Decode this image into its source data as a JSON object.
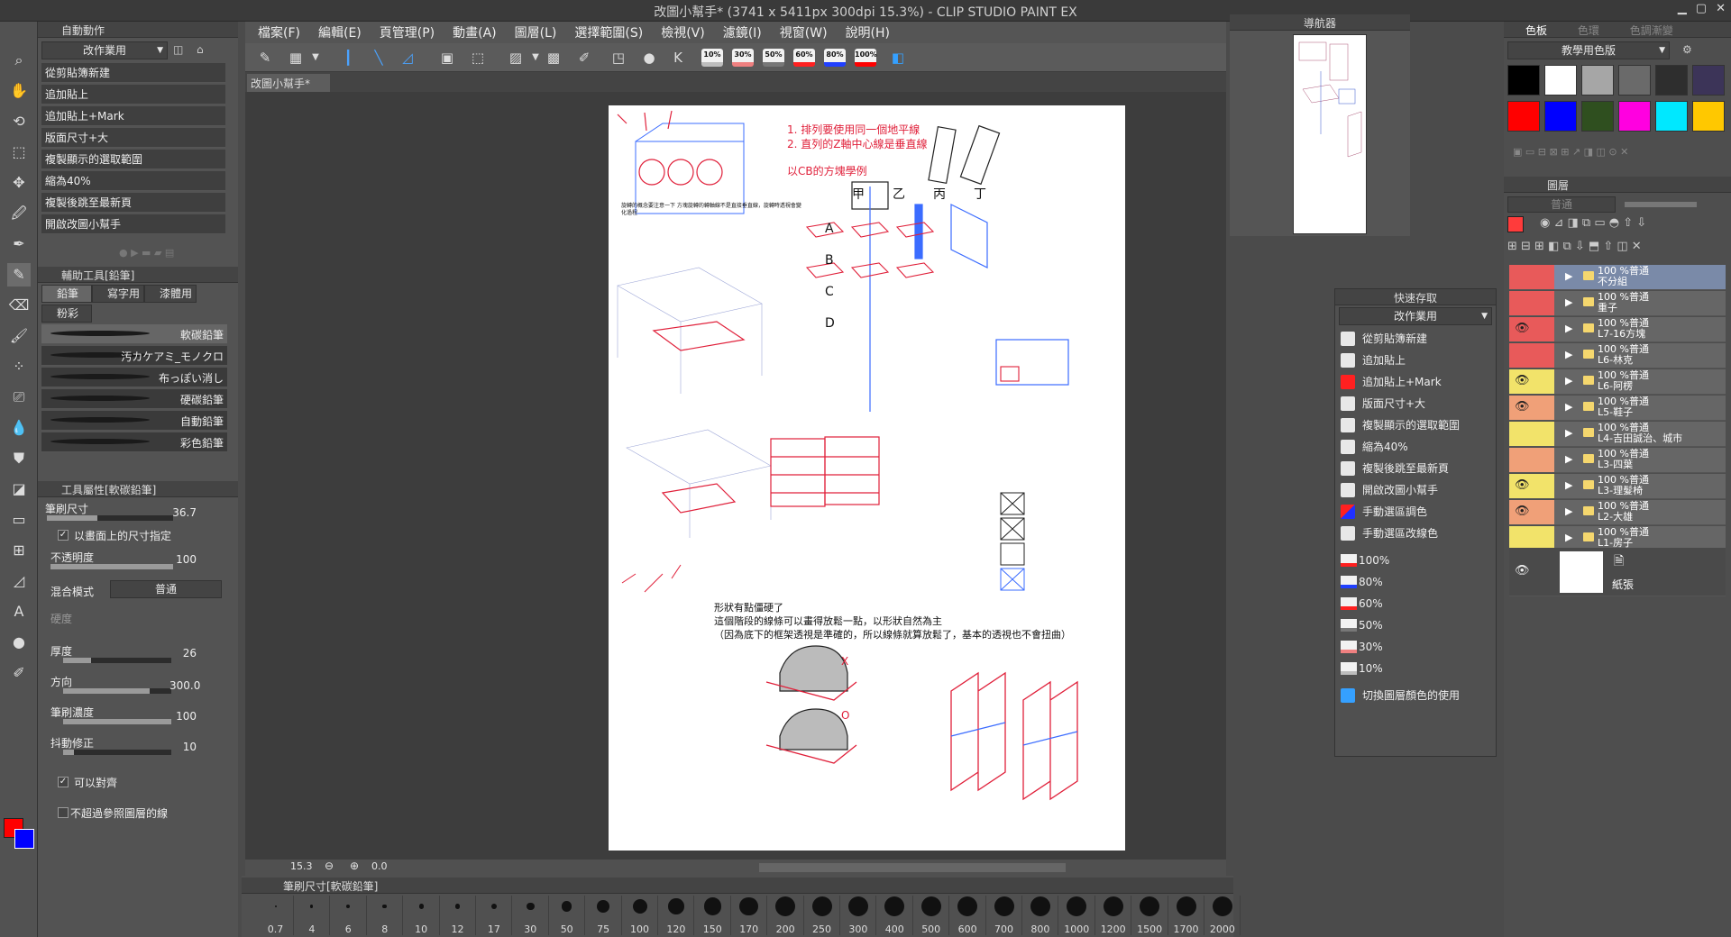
{
  "window": {
    "title": "改圖小幫手* (3741 x 5411px 300dpi 15.3%) - CLIP STUDIO PAINT EX"
  },
  "menu": [
    "檔案(F)",
    "編輯(E)",
    "頁管理(P)",
    "動畫(A)",
    "圖層(L)",
    "選擇範圍(S)",
    "檢視(V)",
    "濾鏡(I)",
    "視窗(W)",
    "說明(H)"
  ],
  "command_bar": {
    "pct_buttons": [
      "10%",
      "30%",
      "50%",
      "60%",
      "80%",
      "100%"
    ]
  },
  "doc_tab": "改圖小幫手*",
  "left": {
    "auto_action": {
      "title": "自動動作",
      "set": "改作業用",
      "items": [
        "從剪貼簿新建",
        "追加貼上",
        "追加貼上+Mark",
        "版面尺寸+大",
        "複製顯示的選取範圍",
        "縮為40%",
        "複製後跳至最新頁",
        "開啟改圖小幫手"
      ]
    },
    "subtool": {
      "title": "輔助工具[鉛筆]",
      "tabs": [
        "鉛筆",
        "寫字用",
        "漆體用",
        "粉彩"
      ],
      "brushes": [
        "軟碳鉛筆",
        "汚カケアミ_モノクロ",
        "布っぽい消し",
        "硬碳鉛筆",
        "自動鉛筆",
        "彩色鉛筆"
      ]
    },
    "props": {
      "title": "工具屬性[軟碳鉛筆]",
      "brush_size_label": "筆刷尺寸",
      "brush_size": "36.7",
      "size_on_screen": "以畫面上的尺寸指定",
      "opacity_label": "不透明度",
      "opacity": "100",
      "blend_label": "混合模式",
      "blend": "普通",
      "hardness_label": "硬度",
      "thickness_label": "厚度",
      "thickness": "26",
      "direction_label": "方向",
      "direction": "300.0",
      "density_label": "筆刷濃度",
      "density": "100",
      "stabilize_label": "抖動修正",
      "stabilize": "10",
      "snap_label": "可以對齊",
      "no_ref_label": "不超過參照圖層的線"
    }
  },
  "status": {
    "zoom": "15.3",
    "angle": "0.0"
  },
  "brush_size_panel": {
    "title": "筆刷尺寸[軟碳鉛筆]",
    "sizes": [
      "0.7",
      "4",
      "6",
      "8",
      "10",
      "12",
      "17",
      "30",
      "50",
      "75",
      "100",
      "120",
      "150",
      "170",
      "200",
      "250",
      "300",
      "400",
      "500",
      "600",
      "700",
      "800",
      "1000",
      "1200",
      "1500",
      "1700",
      "2000"
    ]
  },
  "navigator": {
    "title": "導航器"
  },
  "quick_access": {
    "title": "快速存取",
    "set": "改作業用",
    "items": [
      "從剪貼簿新建",
      "追加貼上",
      "追加貼上+Mark",
      "版面尺寸+大",
      "複製顯示的選取範圍",
      "縮為40%",
      "複製後跳至最新頁",
      "開啟改圖小幫手",
      "手動選區調色",
      "手動選區改線色"
    ],
    "pct_items": [
      "100%",
      "80%",
      "60%",
      "50%",
      "30%",
      "10%"
    ],
    "last": "切換圖層顏色的使用"
  },
  "right": {
    "color_tabs": [
      "色板",
      "色環",
      "色調漸變"
    ],
    "palette_name": "教學用色版",
    "swatches": [
      "#000000",
      "#ffffff",
      "#a6a6a6",
      "#6a6a6a",
      "#2e2e2e",
      "#3c3458",
      "#ff0000",
      "#0000ff",
      "#2f4f1f",
      "#ff00e0",
      "#00e8ff",
      "#ffc800"
    ],
    "layer_title": "圖層",
    "blend": "普通",
    "layers": [
      {
        "pct": "100 %普通",
        "name": "不分組",
        "eye": false,
        "color": "#e85a5a",
        "selected": true
      },
      {
        "pct": "100 %普通",
        "name": "重子",
        "eye": false,
        "color": "#e85a5a"
      },
      {
        "pct": "100 %普通",
        "name": "L7-16方塊",
        "eye": true,
        "color": "#e85a5a"
      },
      {
        "pct": "100 %普通",
        "name": "L6-林克",
        "eye": false,
        "color": "#e85a5a"
      },
      {
        "pct": "100 %普通",
        "name": "L6-阿楞",
        "eye": true,
        "color": "#f2e36a"
      },
      {
        "pct": "100 %普通",
        "name": "L5-鞋子",
        "eye": true,
        "color": "#f0a078"
      },
      {
        "pct": "100 %普通",
        "name": "L4-吉田誠治、城市",
        "eye": false,
        "color": "#f2e36a"
      },
      {
        "pct": "100 %普通",
        "name": "L3-四葉",
        "eye": false,
        "color": "#f0a078"
      },
      {
        "pct": "100 %普通",
        "name": "L3-理髮椅",
        "eye": true,
        "color": "#f2e36a"
      },
      {
        "pct": "100 %普通",
        "name": "L2-大雄",
        "eye": true,
        "color": "#f0a078"
      },
      {
        "pct": "100 %普通",
        "name": "L1-房子",
        "eye": false,
        "color": "#f2e36a"
      }
    ],
    "paper_layer": "紙張"
  },
  "canvas": {
    "red_notes": [
      "1. 排列要使用同一個地平線",
      "2. 直列的Z軸中心線是垂直線",
      "以CB的方塊學例"
    ],
    "row_labels": [
      "甲",
      "乙",
      "丙",
      "丁"
    ],
    "col_labels": [
      "A",
      "B",
      "C",
      "D"
    ],
    "note_lines": [
      "形狀有點僵硬了",
      "這個階段的線條可以畫得放鬆一點，以形狀自然為主",
      "（因為底下的框架透視是準確的，所以線條就算放鬆了，基本的透視也不會扭曲）"
    ],
    "small_note": "旋轉的概念要注意一下 方塊旋轉的轉軸線不是直接垂直線，旋轉時透視會變化過程",
    "ok_marks": [
      "O",
      "X"
    ]
  }
}
